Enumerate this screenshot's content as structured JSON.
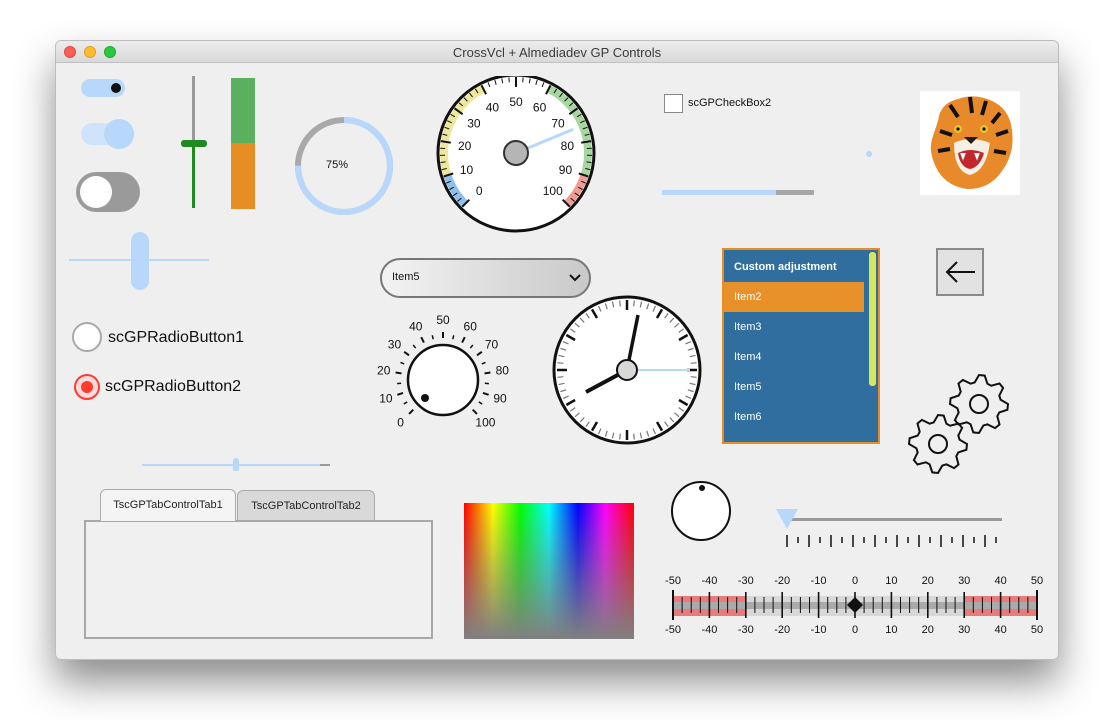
{
  "window": {
    "title": "CrossVcl + Almediadev GP Controls"
  },
  "colors": {
    "accent_blue": "#b7d8fb",
    "orange": "#e68e24",
    "green": "#5ab05f",
    "list_blue": "#2f6e9e",
    "radio_red": "#ff3b30"
  },
  "switches": [
    {
      "state": "on"
    },
    {
      "state": "on"
    },
    {
      "state": "off"
    }
  ],
  "progress_ring": {
    "label": "75%",
    "value": 0.75
  },
  "vertical_meter": {
    "value": 0.5
  },
  "gauge": {
    "ticks": [
      "0",
      "10",
      "20",
      "30",
      "40",
      "50",
      "60",
      "70",
      "80",
      "90",
      "100"
    ],
    "value": 75
  },
  "checkbox": {
    "label": "scGPCheckBox2",
    "checked": false
  },
  "hslider_top": {
    "value": 0.75
  },
  "radios": [
    {
      "label": "scGPRadioButton1",
      "checked": false
    },
    {
      "label": "scGPRadioButton2",
      "checked": true
    }
  ],
  "combobox": {
    "value": "Item5"
  },
  "dial": {
    "ticks": [
      "0",
      "10",
      "20",
      "30",
      "40",
      "50",
      "60",
      "70",
      "80",
      "90",
      "100"
    ]
  },
  "listbox": {
    "items": [
      {
        "label": "Custom adjustment",
        "type": "header"
      },
      {
        "label": "Item2",
        "type": "selected"
      },
      {
        "label": "Item3",
        "type": "item"
      },
      {
        "label": "Item4",
        "type": "item"
      },
      {
        "label": "Item5",
        "type": "item"
      },
      {
        "label": "Item6",
        "type": "item"
      }
    ]
  },
  "back_button": {
    "icon": "arrow-left-icon"
  },
  "gears": {
    "icon": "gears-icon"
  },
  "tabs": [
    {
      "label": "TscGPTabControlTab1",
      "active": true
    },
    {
      "label": "TscGPTabControlTab2",
      "active": false
    }
  ],
  "scale": {
    "labels": [
      "-50",
      "-40",
      "-30",
      "-20",
      "-10",
      "0",
      "10",
      "20",
      "30",
      "40",
      "50"
    ],
    "value": 0
  }
}
